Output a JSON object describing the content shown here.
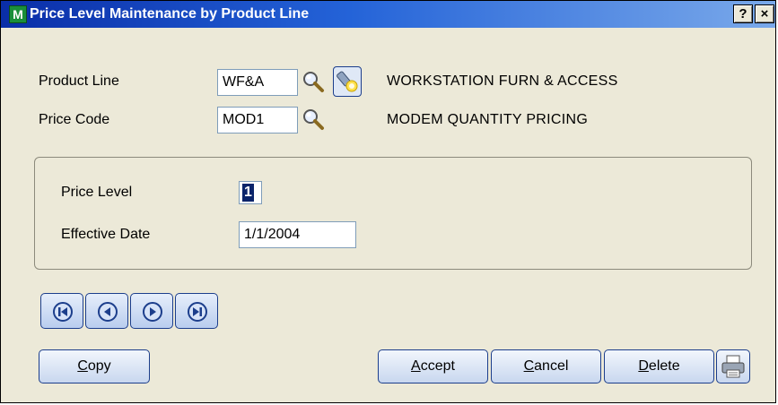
{
  "window": {
    "title": "Price Level Maintenance by Product Line",
    "icon_letter": "M",
    "help_button": "?",
    "close_button": "×"
  },
  "form": {
    "product_line": {
      "label": "Product Line",
      "value": "WF&A",
      "description": "WORKSTATION FURN & ACCESS"
    },
    "price_code": {
      "label": "Price Code",
      "value": "MOD1",
      "description": "MODEM QUANTITY PRICING"
    },
    "price_level": {
      "label": "Price Level",
      "value": "1"
    },
    "effective_date": {
      "label": "Effective Date",
      "value": "1/1/2004"
    }
  },
  "navigation": {
    "buttons": [
      "first-record",
      "previous-record",
      "next-record",
      "last-record"
    ]
  },
  "buttons": {
    "copy": {
      "hotkey": "C",
      "rest": "opy"
    },
    "accept": {
      "hotkey": "A",
      "rest": "ccept"
    },
    "cancel": {
      "hotkey": "C",
      "rest": "ancel"
    },
    "delete": {
      "hotkey": "D",
      "rest": "elete"
    }
  },
  "icons": {
    "lookup": "magnifier-icon",
    "launch": "flashlight-icon",
    "print": "printer-icon"
  },
  "colors": {
    "title_bar_start": "#0a2ea8",
    "title_bar_end": "#7aa9ea",
    "window_bg": "#ece9d8",
    "button_border": "#1c3e8c",
    "selection": "#0a246a"
  }
}
